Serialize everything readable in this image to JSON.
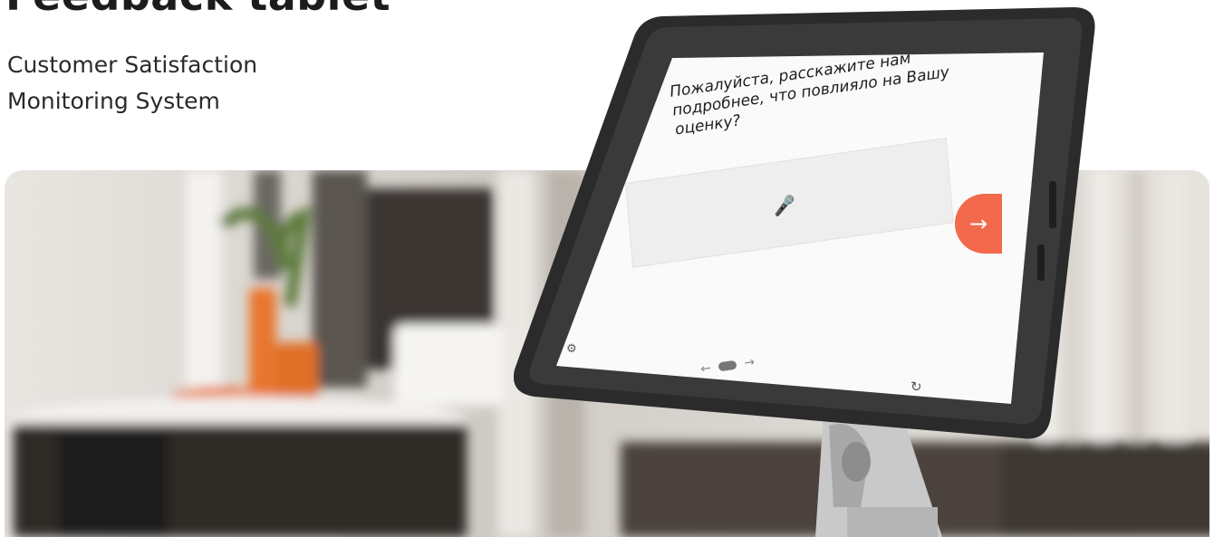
{
  "hero": {
    "title": "Feedback tablet",
    "subtitle_line1": "Customer Satisfaction",
    "subtitle_line2": "Monitoring System"
  },
  "tablet": {
    "question": "Пожалуйста, расскажите нам подробнее, что повлияло на Вашу оценку?",
    "next_arrow": "→",
    "pager_prev": "←",
    "pager_next": "→"
  },
  "colors": {
    "accent": "#f26a4b",
    "frame": "#2b2b2b",
    "planter": "#e8762e"
  },
  "icons": [
    "microphone-icon",
    "arrow-right-icon",
    "settings-icon",
    "refresh-icon"
  ]
}
